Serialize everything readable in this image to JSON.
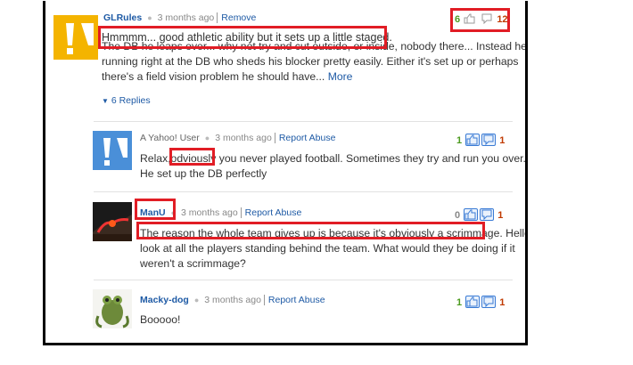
{
  "comments": [
    {
      "user": "GLRules",
      "time": "3 months ago",
      "action": "Remove",
      "up": "6",
      "down": "12",
      "highlight_text": "Hmmmm... good athletic ability but it sets up a little staged.",
      "body_line1": "The DB he leaps over... why not try and cut outside, or inside, nobody there... Instead he's",
      "body_line2": "running right at the DB who sheds his blocker pretty easily. Either it's set up or perhaps",
      "body_line3": "there's a field vision problem he should have...",
      "more": "More",
      "replies": "6 Replies"
    },
    {
      "user": "A Yahoo! User",
      "time": "3 months ago",
      "action": "Report Abuse",
      "up": "1",
      "down": "1",
      "body_pre": "Relax,",
      "body_word": "odviously",
      "body_post": " you never played football. Sometimes they try and run you over.",
      "body_line2": "He set up the DB perfectly"
    },
    {
      "user": "ManU",
      "time": "3 months ago",
      "action": "Report Abuse",
      "up": "0",
      "down": "1",
      "body_highlight": "The reason the whole team gives up is because it's obviously a scrimmage.",
      "body_post": " Hello",
      "body_line2": "look at all the players standing behind the team. What would they be doing if it",
      "body_line3": "weren't a scrimmage?"
    },
    {
      "user": "Macky-dog",
      "time": "3 months ago",
      "action": "Report Abuse",
      "up": "1",
      "down": "1",
      "body": "Booooo!"
    }
  ],
  "colors": {
    "highlight": "#e11d25",
    "link": "#1e5aa5",
    "up": "#4c9a1f",
    "down": "#c03a00"
  },
  "icons": [
    "yahoo-avatar-icon",
    "thumbs-up-icon",
    "thumbs-down-icon",
    "chevron-down-icon"
  ]
}
